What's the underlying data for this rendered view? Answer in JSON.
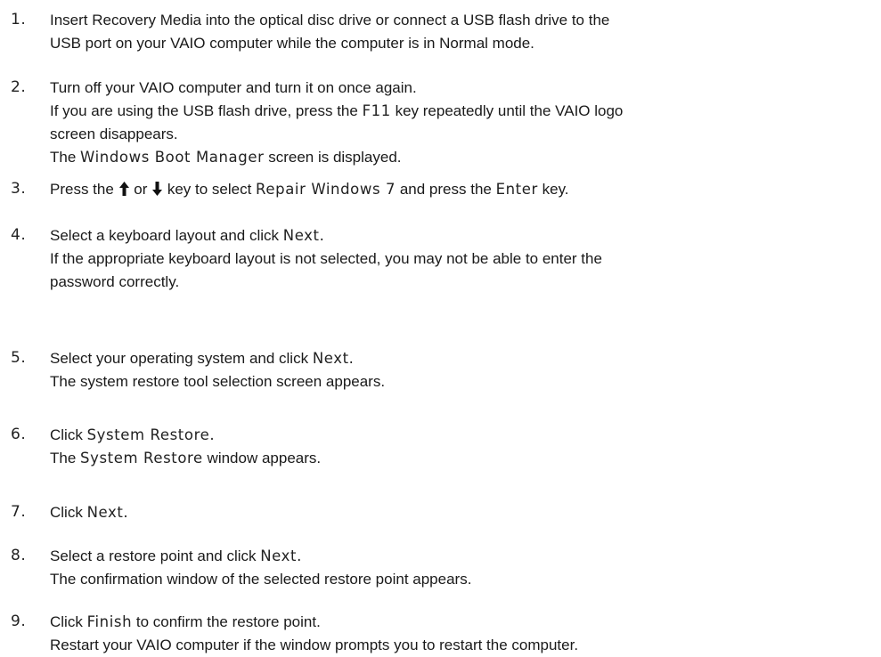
{
  "steps": [
    {
      "number": "1.",
      "lines": [
        [
          {
            "text": "Insert Recovery Media into the optical disc drive or connect a USB flash drive to the"
          }
        ],
        [
          {
            "text": "USB port on your VAIO computer while the computer is in Normal mode."
          }
        ]
      ]
    },
    {
      "number": "2.",
      "lines": [
        [
          {
            "text": "Turn off your VAIO computer and turn it on once again."
          }
        ],
        [
          {
            "text": "If you are using the USB flash drive, press the "
          },
          {
            "text": "F11",
            "ui": true
          },
          {
            "text": " key repeatedly until the VAIO logo"
          }
        ],
        [
          {
            "text": "screen disappears."
          }
        ],
        [
          {
            "text": "The "
          },
          {
            "text": "Windows Boot Manager",
            "ui": true
          },
          {
            "text": " screen is displayed."
          }
        ]
      ]
    },
    {
      "number": "3.",
      "lines": [
        [
          {
            "text": "Press the "
          },
          {
            "icon": "up-arrow-icon"
          },
          {
            "text": " or "
          },
          {
            "icon": "down-arrow-icon"
          },
          {
            "text": " key to select "
          },
          {
            "text": "Repair Windows 7",
            "ui": true
          },
          {
            "text": " and press the "
          },
          {
            "text": "Enter",
            "ui": true
          },
          {
            "text": " key."
          }
        ]
      ]
    },
    {
      "number": "4.",
      "lines": [
        [
          {
            "text": "Select a keyboard layout and click "
          },
          {
            "text": "Next.",
            "ui": true
          }
        ],
        [
          {
            "text": "If the appropriate keyboard layout is not selected, you may not be able to enter the"
          }
        ],
        [
          {
            "text": "password correctly."
          }
        ]
      ]
    },
    {
      "number": "5.",
      "lines": [
        [
          {
            "text": "Select your operating system and click "
          },
          {
            "text": "Next.",
            "ui": true
          }
        ],
        [
          {
            "text": "The system restore tool selection screen appears."
          }
        ]
      ]
    },
    {
      "number": "6.",
      "lines": [
        [
          {
            "text": "Click "
          },
          {
            "text": "System Restore.",
            "ui": true
          }
        ],
        [
          {
            "text": "The "
          },
          {
            "text": "System Restore",
            "ui": true
          },
          {
            "text": " window appears."
          }
        ]
      ]
    },
    {
      "number": "7.",
      "lines": [
        [
          {
            "text": "Click "
          },
          {
            "text": "Next.",
            "ui": true
          }
        ]
      ]
    },
    {
      "number": "8.",
      "lines": [
        [
          {
            "text": "Select a restore point and click "
          },
          {
            "text": "Next.",
            "ui": true
          }
        ],
        [
          {
            "text": "The confirmation window of the selected restore point appears."
          }
        ]
      ]
    },
    {
      "number": "9.",
      "lines": [
        [
          {
            "text": "Click "
          },
          {
            "text": "Finish",
            "ui": true
          },
          {
            "text": " to confirm the restore point."
          }
        ],
        [
          {
            "text": "Restart your VAIO computer if the window prompts you to restart the computer."
          }
        ]
      ]
    }
  ]
}
